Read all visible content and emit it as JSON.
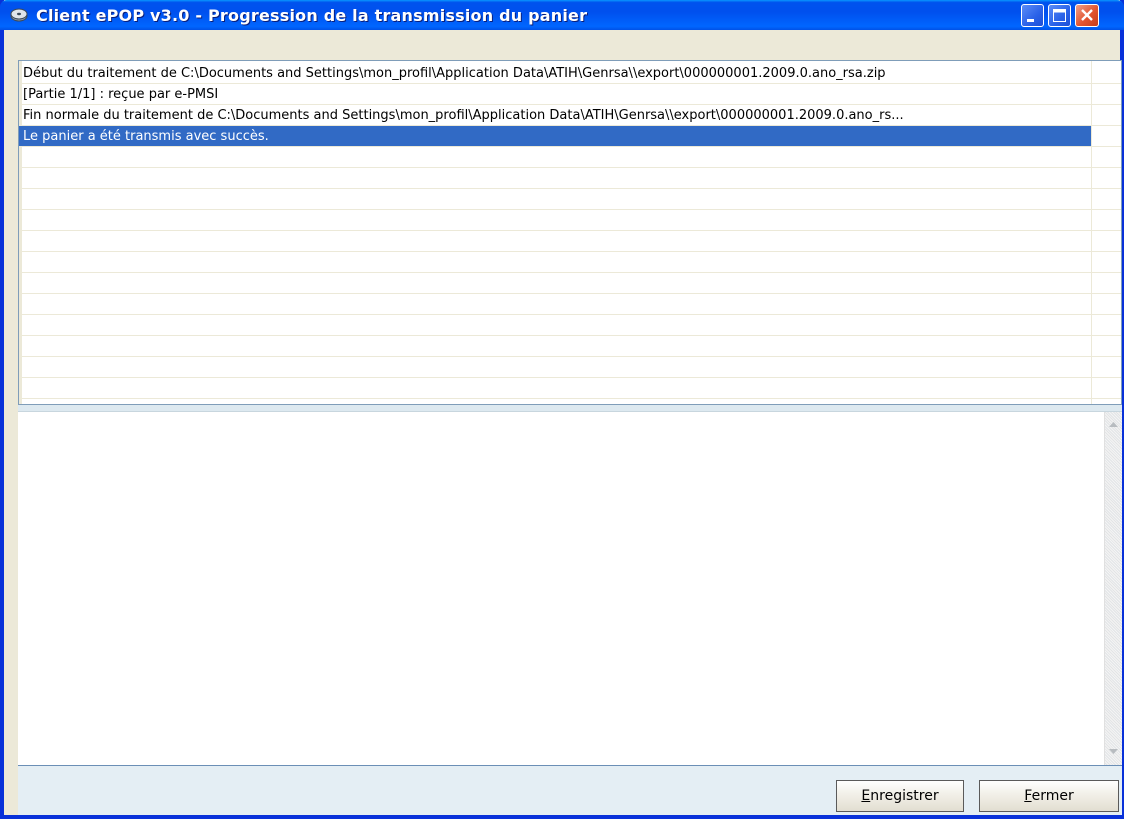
{
  "window": {
    "title": "Client ePOP v3.0 - Progression de la transmission du panier",
    "icon": "app-disc-icon",
    "controls": [
      "minimize-icon",
      "maximize-icon",
      "close-icon"
    ]
  },
  "log": {
    "rows": [
      {
        "text": "Début du traitement de C:\\Documents and Settings\\mon_profil\\Application Data\\ATIH\\Genrsa\\\\export\\000000001.2009.0.ano_rsa.zip",
        "selected": false
      },
      {
        "text": "[Partie 1/1] : reçue par e-PMSI",
        "selected": false
      },
      {
        "text": "Fin normale du traitement de C:\\Documents and Settings\\mon_profil\\Application Data\\ATIH\\Genrsa\\\\export\\000000001.2009.0.ano_rs...",
        "selected": false
      },
      {
        "text": "Le panier a été transmis avec succès.",
        "selected": true
      }
    ]
  },
  "buttons": {
    "save": {
      "mnemonic": "E",
      "rest": "nregistrer"
    },
    "close": {
      "mnemonic": "F",
      "rest": "ermer"
    }
  },
  "colors": {
    "titlebar": "#0053ee",
    "selection": "#316ac5",
    "footer": "#e4eef4"
  }
}
